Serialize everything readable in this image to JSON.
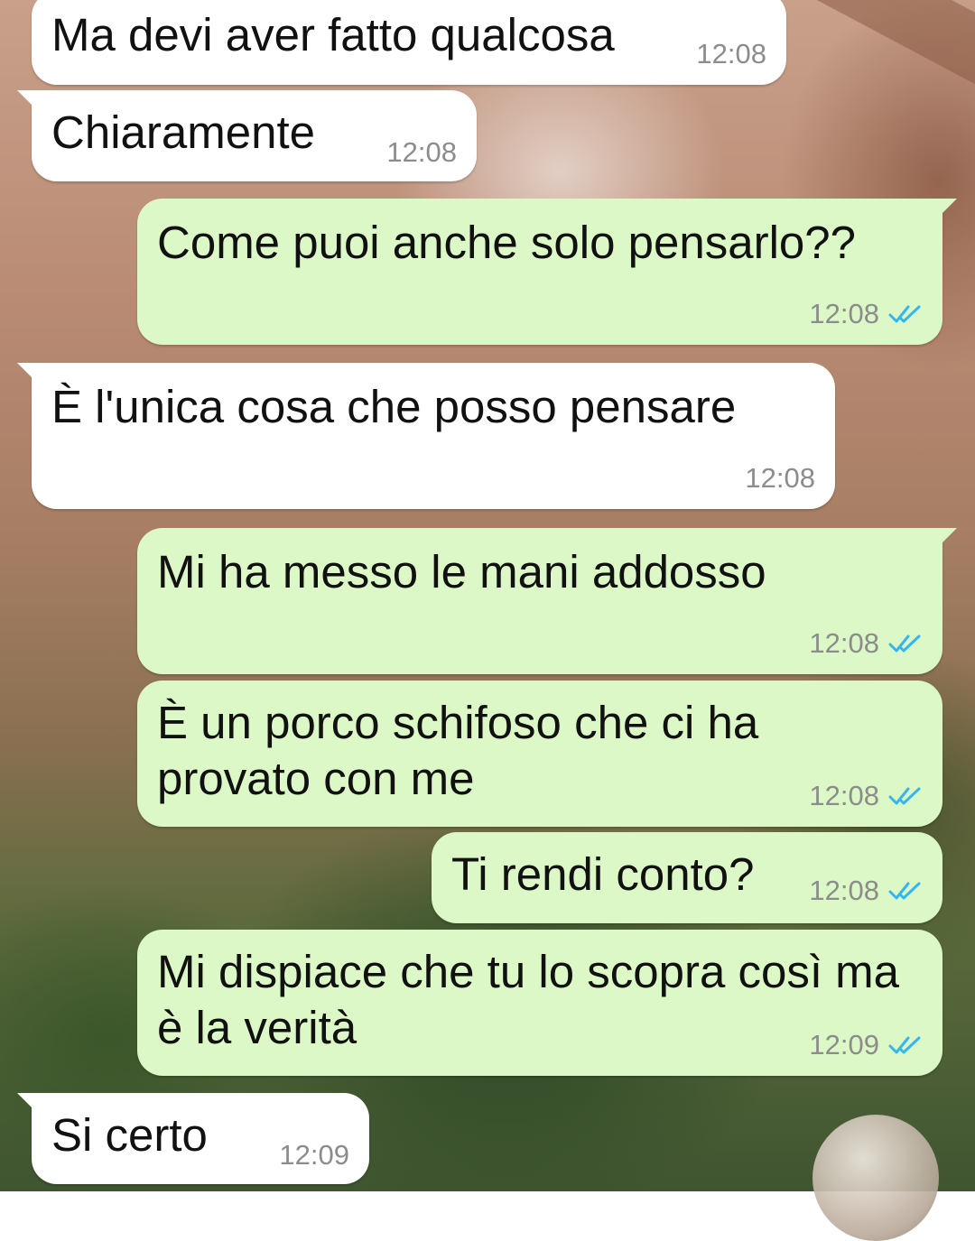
{
  "conversation": {
    "messages": [
      {
        "text": "Ma devi aver fatto qualcosa",
        "time": "12:08",
        "direction": "incoming"
      },
      {
        "text": "Chiaramente",
        "time": "12:08",
        "direction": "incoming"
      },
      {
        "text": "Come puoi anche solo pensarlo??",
        "time": "12:08",
        "direction": "outgoing",
        "status": "read"
      },
      {
        "text": "È l'unica cosa che posso pensare",
        "time": "12:08",
        "direction": "incoming"
      },
      {
        "text": "Mi ha messo le mani addosso",
        "time": "12:08",
        "direction": "outgoing",
        "status": "read"
      },
      {
        "text": "È un porco schifoso che ci ha\nprovato con me",
        "time": "12:08",
        "direction": "outgoing",
        "status": "read"
      },
      {
        "text": "Ti rendi conto?",
        "time": "12:08",
        "direction": "outgoing",
        "status": "read"
      },
      {
        "text": "Mi dispiace che tu lo scopra così ma\nè la verità",
        "time": "12:09",
        "direction": "outgoing",
        "status": "read"
      },
      {
        "text": "Si certo",
        "time": "12:09",
        "direction": "incoming"
      }
    ]
  },
  "colors": {
    "incoming_bubble": "#ffffff",
    "outgoing_bubble": "#dcf8c6",
    "timestamp": "#8c8c8c",
    "read_ticks": "#34b7f1"
  },
  "icons": {
    "read_status": "double-check-icon"
  }
}
